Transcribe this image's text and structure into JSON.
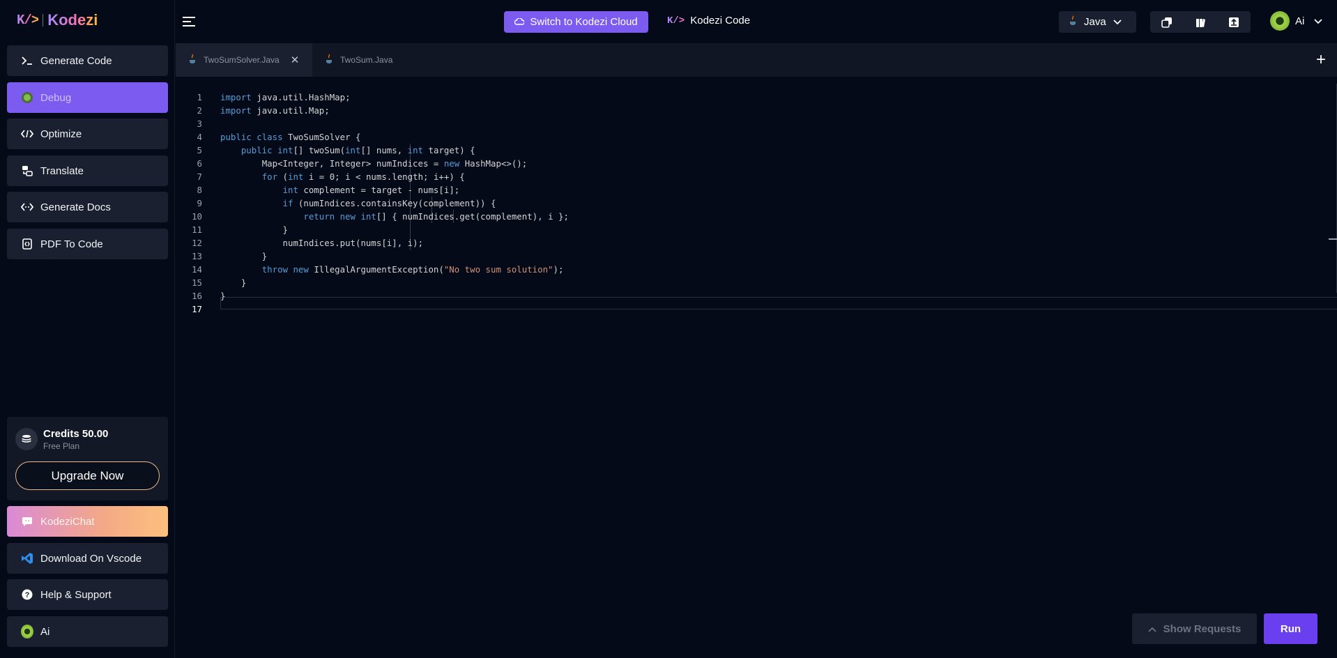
{
  "brand": {
    "name": "Kodezi",
    "mark": "K/>"
  },
  "sidebar": {
    "items": [
      {
        "label": "Generate Code",
        "icon": "terminal-icon"
      },
      {
        "label": "Debug",
        "icon": "debug-icon"
      },
      {
        "label": "Optimize",
        "icon": "code-icon"
      },
      {
        "label": "Translate",
        "icon": "translate-icon"
      },
      {
        "label": "Generate Docs",
        "icon": "docs-icon"
      },
      {
        "label": "PDF To Code",
        "icon": "pdf-icon"
      }
    ],
    "active_index": 1,
    "credits": {
      "title": "Credits 50.00",
      "plan": "Free Plan",
      "upgrade_label": "Upgrade Now"
    },
    "bottom_items": [
      {
        "label": "KodeziChat",
        "icon": "chat-icon"
      },
      {
        "label": "Download On Vscode",
        "icon": "vscode-icon"
      },
      {
        "label": "Help & Support",
        "icon": "help-icon"
      },
      {
        "label": "Ai",
        "icon": "avatar-icon"
      }
    ]
  },
  "topbar": {
    "switch_label": "Switch to Kodezi Cloud",
    "product_label": "Kodezi Code",
    "language": "Java",
    "user_name": "Ai"
  },
  "tabs": [
    {
      "label": "TwoSumSolver.Java",
      "active": true
    },
    {
      "label": "TwoSum.Java",
      "active": false
    }
  ],
  "editor": {
    "current_line": 17,
    "lines": [
      "import java.util.HashMap;",
      "import java.util.Map;",
      "",
      "public class TwoSumSolver {",
      "    public int[] twoSum(int[] nums, int target) {",
      "        Map<Integer, Integer> numIndices = new HashMap<>();",
      "        for (int i = 0; i < nums.length; i++) {",
      "            int complement = target - nums[i];",
      "            if (numIndices.containsKey(complement)) {",
      "                return new int[] { numIndices.get(complement), i };",
      "            }",
      "            numIndices.put(nums[i], i);",
      "        }",
      "        throw new IllegalArgumentException(\"No two sum solution\");",
      "    }",
      "}",
      ""
    ]
  },
  "actions": {
    "show_requests_label": "Show Requests",
    "run_label": "Run"
  },
  "colors": {
    "accent": "#7c5cf0",
    "run": "#6a3ff0",
    "background": "#050a18",
    "keyword": "#569cd6",
    "string": "#ce9178"
  }
}
